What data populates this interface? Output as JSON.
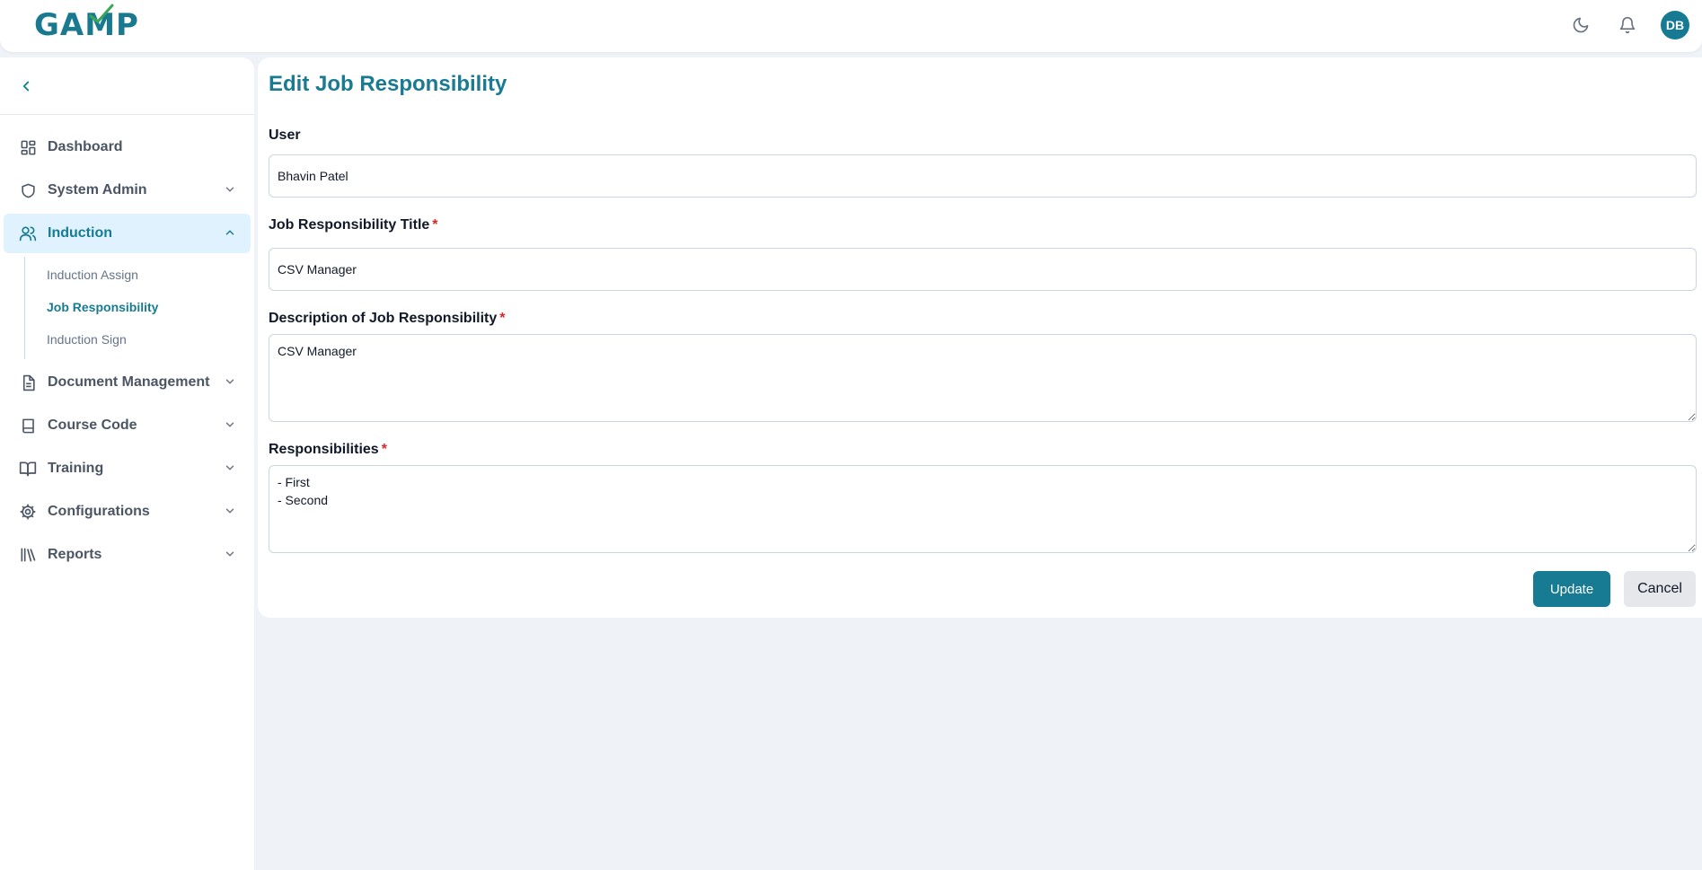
{
  "header": {
    "logo_text": "GAMP",
    "user_initials": "DB",
    "icons": [
      "moon-icon",
      "bell-icon"
    ]
  },
  "sidebar": {
    "items": [
      {
        "label": "Dashboard",
        "icon": "dashboard-icon"
      },
      {
        "label": "System Admin",
        "icon": "shield-icon"
      },
      {
        "label": "Induction",
        "icon": "users-icon",
        "active": true,
        "children": [
          {
            "label": "Induction Assign"
          },
          {
            "label": "Job Responsibility",
            "active": true
          },
          {
            "label": "Induction Sign"
          }
        ]
      },
      {
        "label": "Document Management",
        "icon": "document-icon"
      },
      {
        "label": "Course Code",
        "icon": "book-icon"
      },
      {
        "label": "Training",
        "icon": "open-book-icon"
      },
      {
        "label": "Configurations",
        "icon": "gear-icon"
      },
      {
        "label": "Reports",
        "icon": "library-icon"
      }
    ]
  },
  "form": {
    "title": "Edit Job Responsibility",
    "user_label": "User",
    "user_value": "Bhavin Patel",
    "title_label": "Job Responsibility Title",
    "title_value": "CSV Manager",
    "description_label": "Description of Job Responsibility",
    "description_value": "CSV Manager",
    "responsibilities_label": "Responsibilities",
    "responsibilities_value": "- First\n- Second",
    "required_mark": "*",
    "update_label": "Update",
    "cancel_label": "Cancel"
  },
  "colors": {
    "accent": "#177b93",
    "required": "#dc2626",
    "background": "#eff3f7",
    "active_nav_bg": "#e0f2fe"
  }
}
